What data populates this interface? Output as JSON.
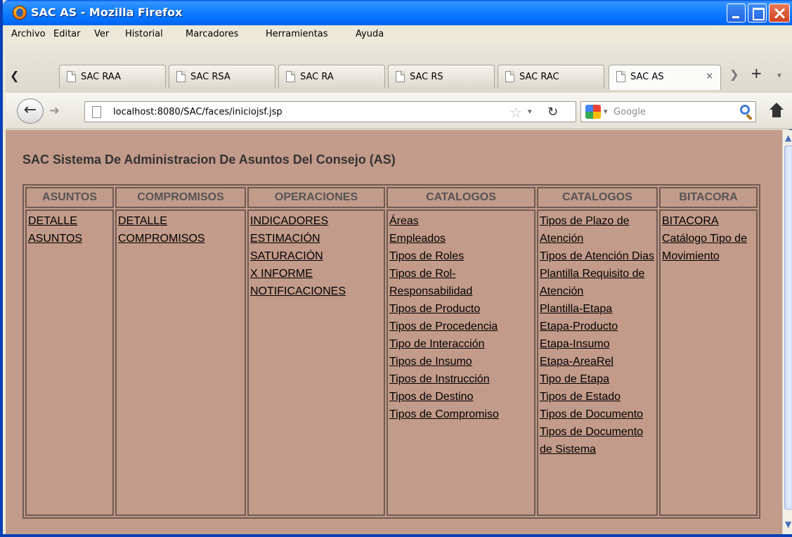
{
  "window": {
    "title": "SAC AS - Mozilla Firefox"
  },
  "menubar": [
    "Archivo",
    "Editar",
    "Ver",
    "Historial",
    "Marcadores",
    "Herramientas",
    "Ayuda"
  ],
  "tabs": [
    {
      "label": "SAC RAA",
      "active": false
    },
    {
      "label": "SAC RSA",
      "active": false
    },
    {
      "label": "SAC RA",
      "active": false
    },
    {
      "label": "SAC RS",
      "active": false
    },
    {
      "label": "SAC RAC",
      "active": false
    },
    {
      "label": "SAC AS",
      "active": true
    }
  ],
  "tab_close_glyph": "×",
  "address_bar": {
    "url": "localhost:8080/SAC/faces/iniciojsf.jsp"
  },
  "search_bar": {
    "placeholder": "Google"
  },
  "page": {
    "title": "SAC Sistema De Administracion De Asuntos Del Consejo (AS)",
    "columns": [
      {
        "header": "ASUNTOS",
        "links": [
          "DETALLE ASUNTOS"
        ]
      },
      {
        "header": "COMPROMISOS",
        "links": [
          "DETALLE COMPROMISOS"
        ]
      },
      {
        "header": "OPERACIONES",
        "links": [
          "INDICADORES",
          "ESTIMACIÓN",
          "SATURACIÓN",
          "X INFORME",
          "NOTIFICACIONES"
        ]
      },
      {
        "header": "CATALOGOS",
        "links": [
          "Áreas",
          "Empleados",
          "Tipos de Roles",
          "Tipos de Rol-Responsabilidad",
          "Tipos de Producto",
          "Tipos de Procedencia",
          "Tipo de Interacción",
          "Tipos de Insumo",
          "Tipos de Instrucción",
          "Tipos de Destino",
          "Tipos de Compromiso"
        ]
      },
      {
        "header": "CATALOGOS",
        "links": [
          "Tipos de Plazo de Atención",
          "Tipos de Atención Dias",
          "Plantilla Requisito de Atención",
          "Plantilla-Etapa",
          "Etapa-Producto",
          "Etapa-Insumo",
          "Etapa-AreaRel",
          "Tipo de Etapa",
          "Tipos de Estado",
          "Tipos de Documento",
          "Tipos de Documento de Sistema"
        ]
      },
      {
        "header": "BITACORA",
        "links": [
          "BITACORA",
          "Catálogo Tipo de Movimiento"
        ]
      }
    ]
  },
  "colors": {
    "page_background": "#c39b8a",
    "titlebar": "#127dff"
  }
}
